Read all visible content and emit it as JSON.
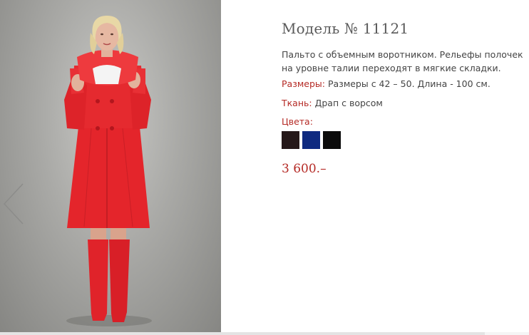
{
  "product": {
    "title": "Модель № 11121",
    "description": "Пальто с объемным воротником. Рельефы полочек на уровне талии переходят в мягкие складки.",
    "sizes_label": "Размеры:",
    "sizes_value": "Размеры с 42 – 50. Длина - 100 см.",
    "fabric_label": "Ткань:",
    "fabric_value": "Драп с ворсом",
    "colors_label": "Цвета:",
    "colors": [
      {
        "name": "dark-brown",
        "hex": "#251819"
      },
      {
        "name": "navy",
        "hex": "#0f2a80"
      },
      {
        "name": "black",
        "hex": "#0b0b0b"
      }
    ],
    "price": "3 600.–"
  },
  "theme": {
    "accent": "#b52a25",
    "coat_red": "#e4252b"
  },
  "gallery": {
    "photo": "woman-in-red-coat-photo",
    "prev_icon": "chevron-left-icon"
  }
}
